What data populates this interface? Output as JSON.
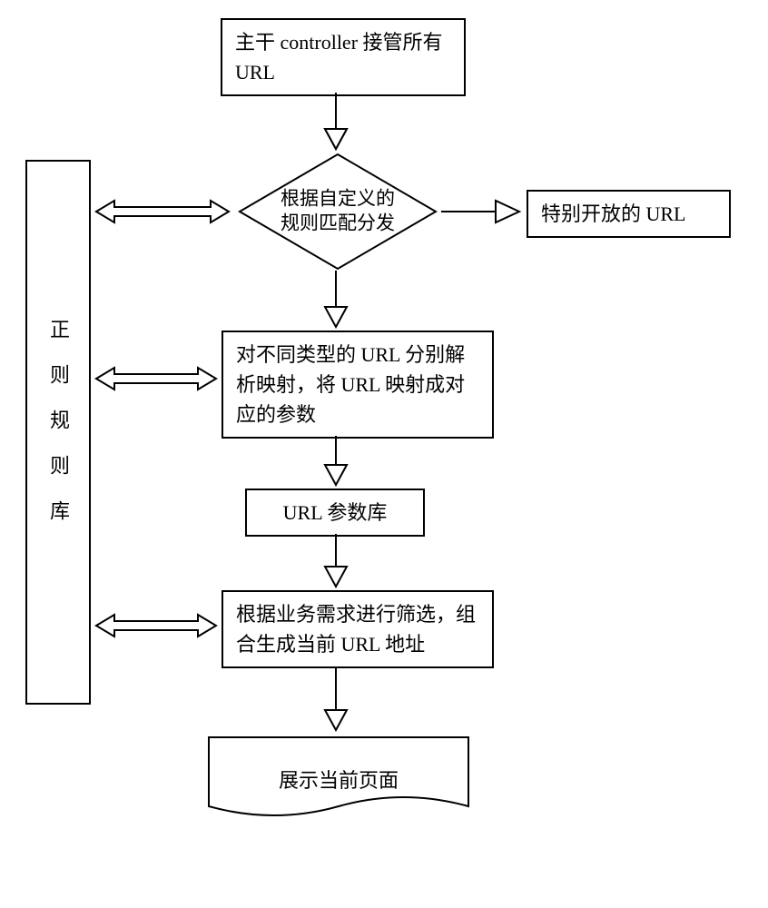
{
  "sidebar_label": "正则规则库",
  "flow": {
    "step1": "主干 controller 接管所有 URL",
    "decision_line1": "根据自定义的",
    "decision_line2": "规则匹配分发",
    "special_url": "特别开放的 URL",
    "step2": "对不同类型的 URL 分别解析映射，将 URL 映射成对应的参数",
    "param_store": "URL 参数库",
    "step3": "根据业务需求进行筛选，组合生成当前 URL 地址",
    "display": "展示当前页面"
  }
}
